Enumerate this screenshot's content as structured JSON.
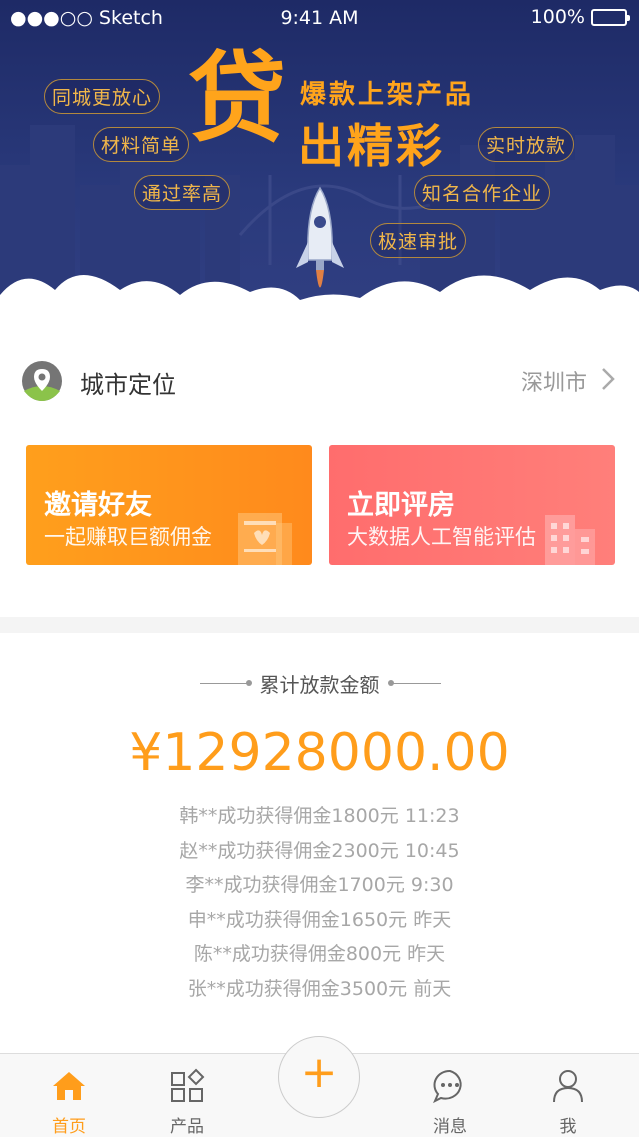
{
  "status_bar": {
    "carrier": "●●●○○ Sketch",
    "time": "9:41 AM",
    "battery": "100%"
  },
  "banner": {
    "big_char": "贷",
    "slogan_line1": "爆款上架产品",
    "slogan_line2": "出精彩",
    "tags": [
      "同城更放心",
      "材料简单",
      "通过率高",
      "实时放款",
      "知名合作企业",
      "极速审批"
    ]
  },
  "location": {
    "label": "城市定位",
    "city": "深圳市"
  },
  "promos": [
    {
      "title": "邀请好友",
      "subtitle": "一起赚取巨额佣金"
    },
    {
      "title": "立即评房",
      "subtitle": "大数据人工智能评估"
    }
  ],
  "stats": {
    "title": "累计放款金额",
    "amount": "¥12928000.00",
    "records": [
      "韩**成功获得佣金1800元  11:23",
      "赵**成功获得佣金2300元  10:45",
      "李**成功获得佣金1700元  9:30",
      "申**成功获得佣金1650元  昨天",
      "陈**成功获得佣金800元  昨天",
      "张**成功获得佣金3500元  前天"
    ]
  },
  "tabbar": {
    "home": "首页",
    "products": "产品",
    "plus": "+",
    "messages": "消息",
    "me": "我"
  },
  "colors": {
    "accent": "#ff9d1b",
    "hero_bg": "#25316e",
    "promo_orange": "#ff951c",
    "promo_red": "#ff7474"
  }
}
